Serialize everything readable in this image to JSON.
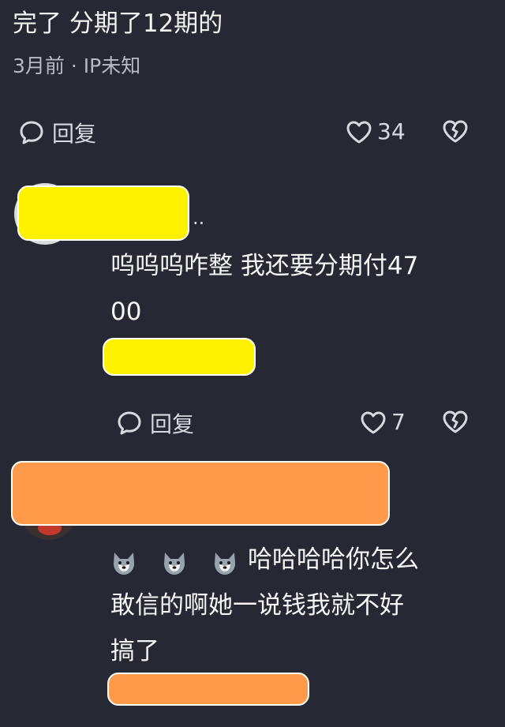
{
  "top_comment": {
    "text": "完了 分期了12期的",
    "meta": "3月前 · IP未知",
    "reply_label": "回复",
    "like_count": "34",
    "icons": [
      "reply-bubble-icon",
      "heart-outline-icon",
      "broken-heart-icon"
    ]
  },
  "reply1": {
    "ellipsis": "..",
    "text_line1": "呜呜呜咋整 我还要分期付47",
    "text_line2": "00",
    "reply_label": "回复",
    "like_count": "7",
    "redaction_color": "#fff200"
  },
  "reply2": {
    "emoji": [
      "husky-emoji",
      "husky-emoji",
      "husky-emoji"
    ],
    "text_line1": "哈哈哈哈你怎么",
    "text_line2": "敢信的啊她一说钱我就不好",
    "text_line3": "搞了",
    "redaction_color": "#ff9a4a"
  },
  "colors": {
    "background": "#262833",
    "text": "#f5f5f5",
    "meta": "#b9bac2"
  }
}
